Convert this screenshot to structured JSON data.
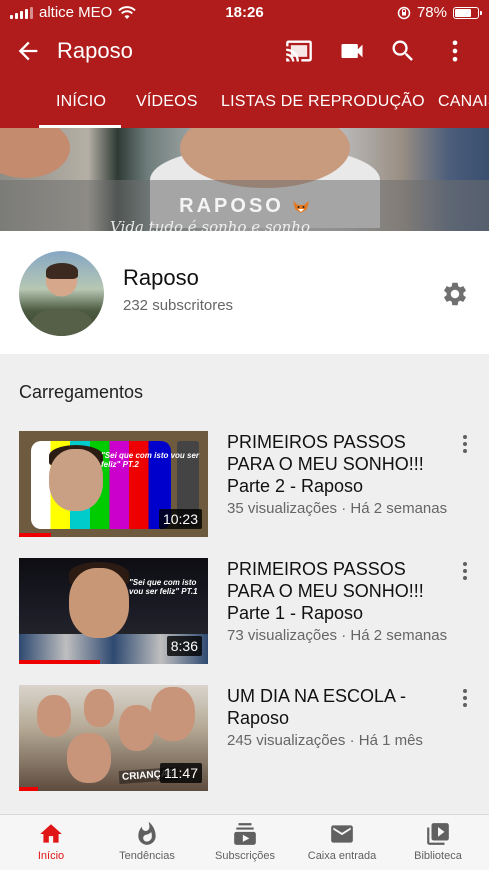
{
  "status_bar": {
    "carrier": "altice MEO",
    "time": "18:26",
    "battery": "78%",
    "battery_level": 0.78
  },
  "app_bar": {
    "title": "Raposo"
  },
  "tabs": [
    {
      "label": "INÍCIO",
      "active": true
    },
    {
      "label": "VÍDEOS"
    },
    {
      "label": "LISTAS DE REPRODUÇÃO"
    },
    {
      "label": "CANAIS"
    }
  ],
  "banner": {
    "text": "RAPOSO",
    "script_text": "Vida tudo é sonho e sonho"
  },
  "channel": {
    "name": "Raposo",
    "subscribers": "232 subscritores"
  },
  "uploads": {
    "section_title": "Carregamentos",
    "videos": [
      {
        "title": "PRIMEIROS PASSOS PARA O MEU SONHO!!! Parte 2 - Raposo",
        "meta": "35 visualizações · Há 2 semanas",
        "duration": "10:23",
        "thumb_caption": "\"Sei que com isto vou ser feliz\" PT.2",
        "watched": 0.17
      },
      {
        "title": "PRIMEIROS PASSOS PARA O MEU SONHO!!! Parte 1 - Raposo",
        "meta": "73 visualizações · Há 2 semanas",
        "duration": "8:36",
        "thumb_caption": "\"Sei que com isto vou ser feliz\" PT.1",
        "watched": 0.43
      },
      {
        "title": "UM DIA NA ESCOLA - Raposo",
        "meta": "245 visualizações · Há 1 mês",
        "duration": "11:47",
        "thumb_caption": "CRIANÇAS",
        "watched": 0.1
      }
    ]
  },
  "bottom_nav": [
    {
      "label": "Início",
      "icon": "home-icon",
      "active": true
    },
    {
      "label": "Tendências",
      "icon": "flame-icon"
    },
    {
      "label": "Subscrições",
      "icon": "subscriptions-icon"
    },
    {
      "label": "Caixa entrada",
      "icon": "mail-icon"
    },
    {
      "label": "Biblioteca",
      "icon": "library-icon"
    }
  ],
  "colors": {
    "brand": "#b01c1c",
    "active_nav": "#e01616",
    "progress": "#ee0000"
  }
}
